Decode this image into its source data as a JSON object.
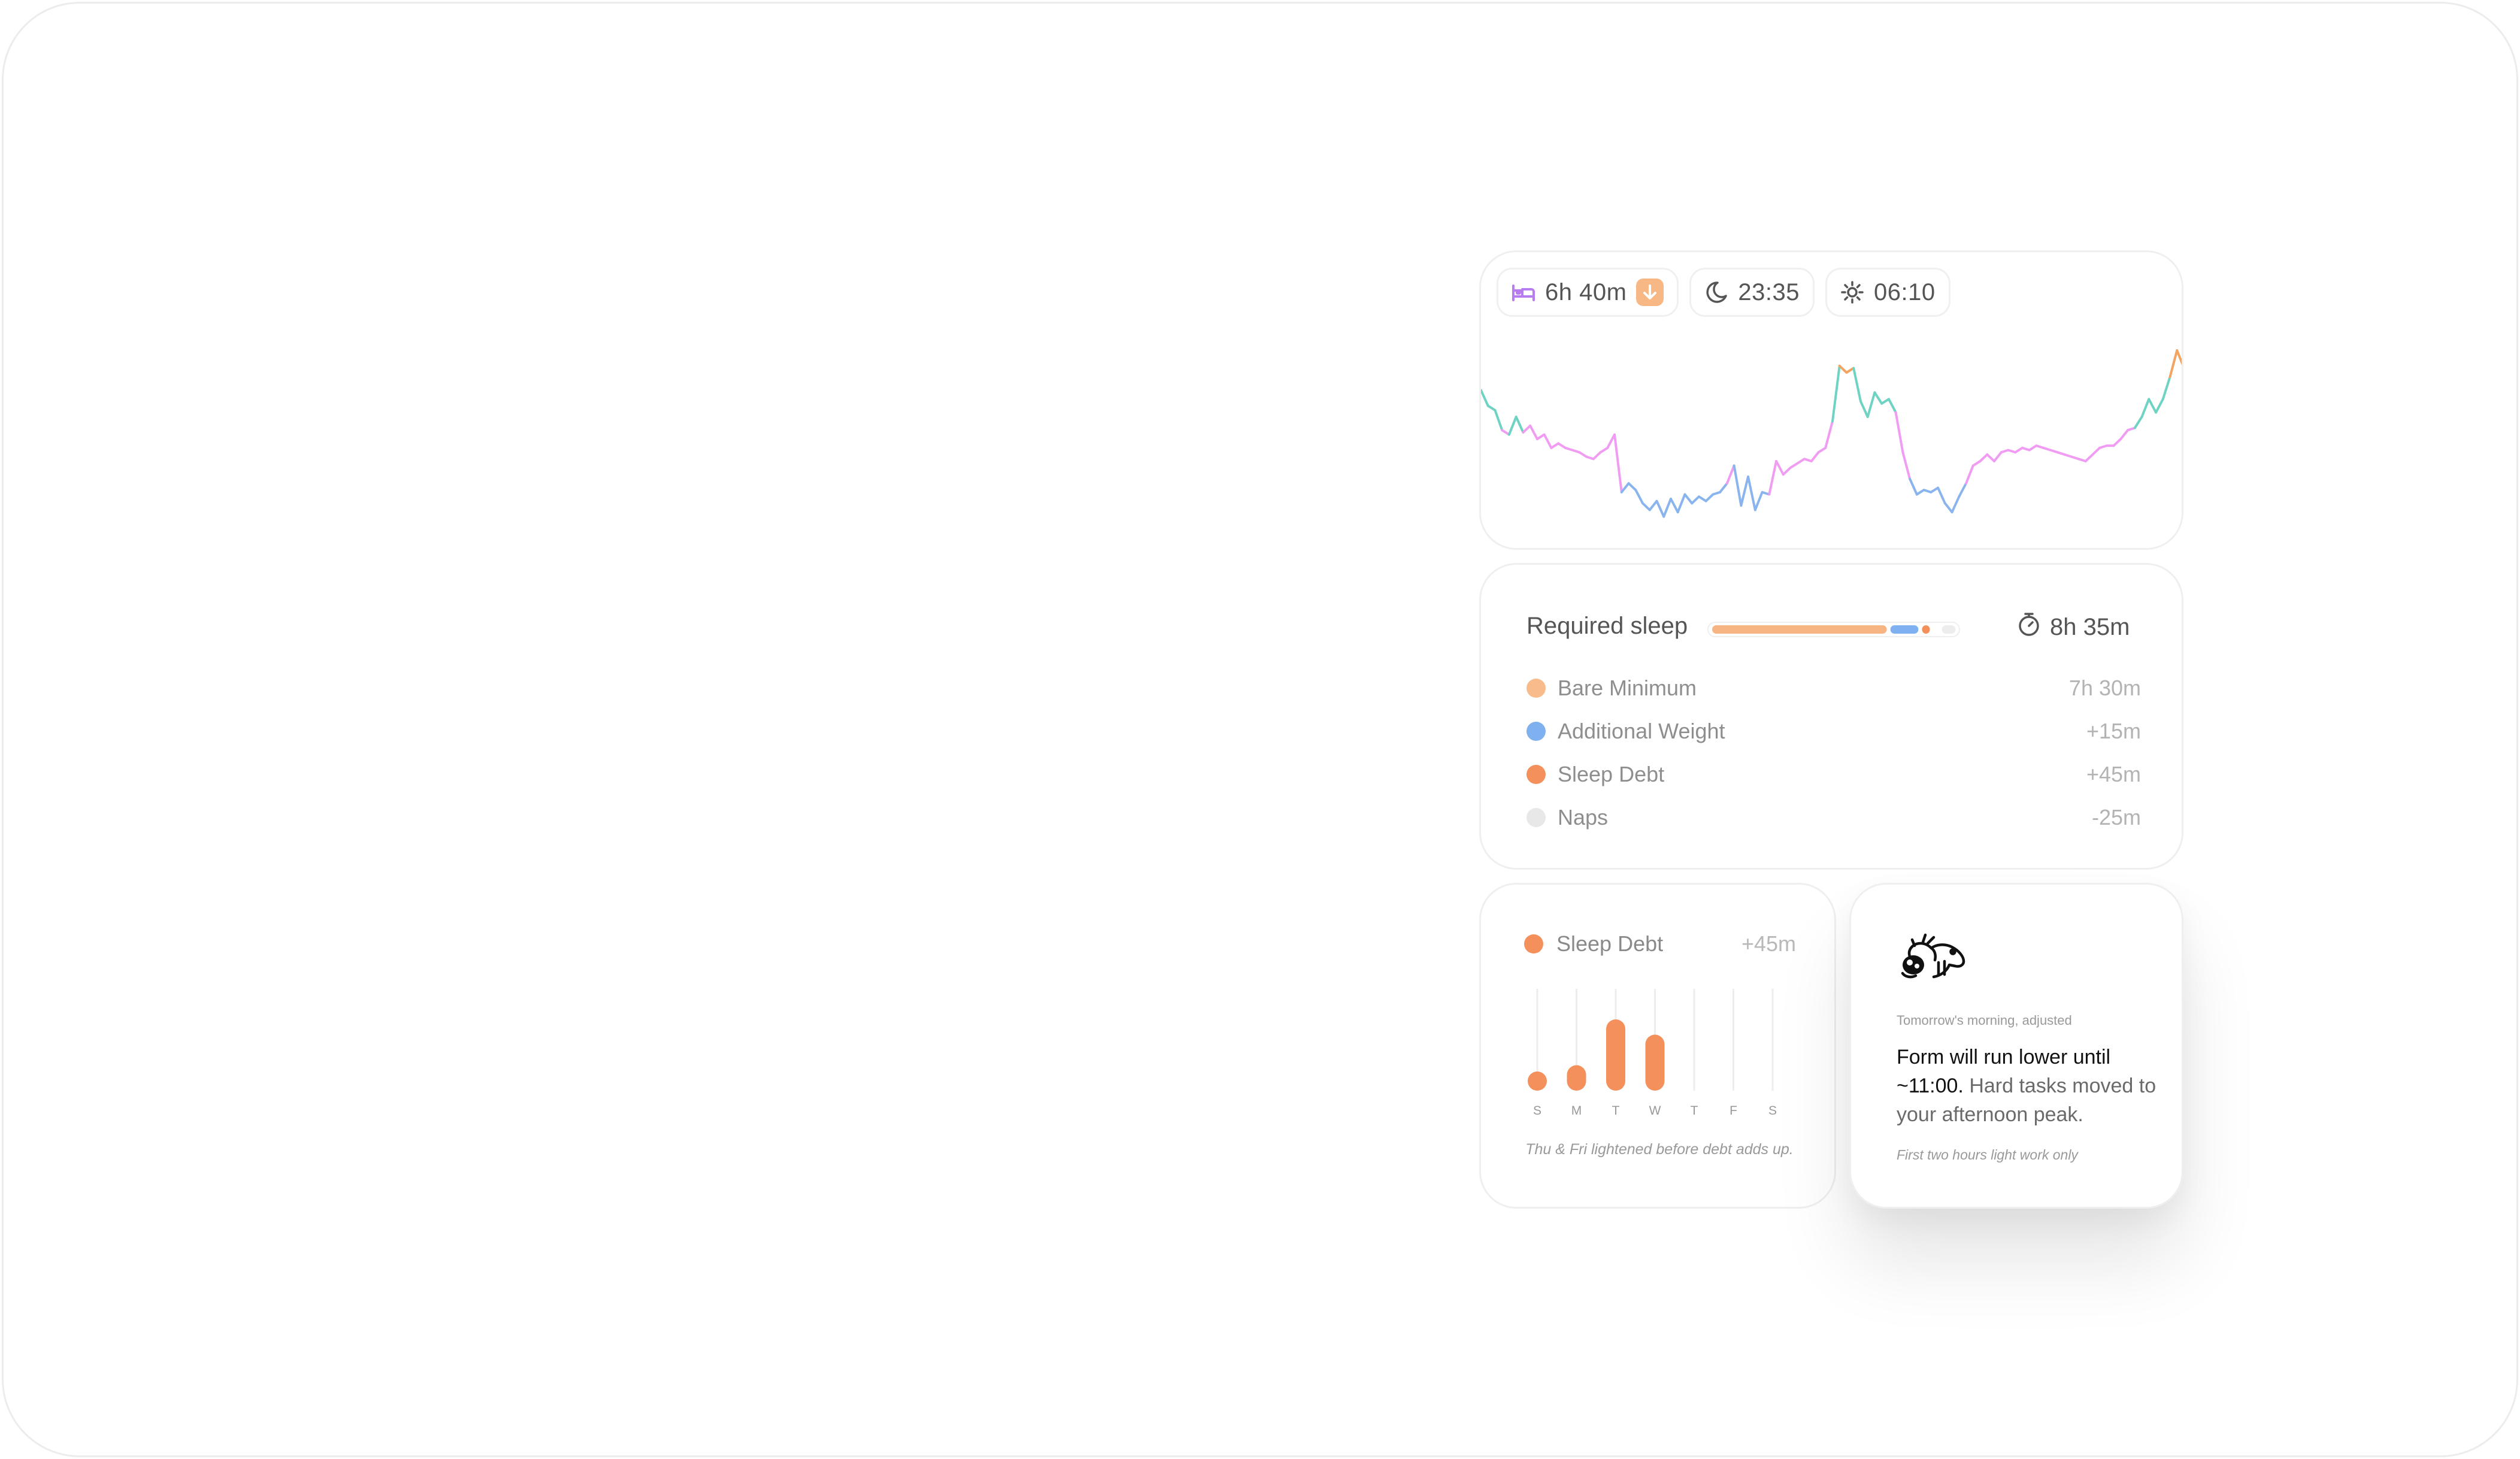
{
  "chart_card": {
    "duration": "6h 40m",
    "bedtime": "23:35",
    "wake_time": "06:10",
    "icons": [
      "bed-icon",
      "arrow-down-icon",
      "moon-icon",
      "sun-icon"
    ]
  },
  "chart_data": {
    "type": "line",
    "description_colors": {
      "low": "#8ab4ee",
      "mid": "#f19cf3",
      "high": "#6fd3c4",
      "peak": "#f2a463"
    },
    "values": [
      62,
      55,
      53,
      44,
      42,
      50,
      43,
      46,
      40,
      42,
      36,
      38,
      36,
      35,
      34,
      32,
      31,
      34,
      36,
      42,
      16,
      20,
      17,
      11,
      8,
      12,
      5,
      13,
      7,
      15,
      11,
      14,
      12,
      15,
      16,
      20,
      28,
      10,
      23,
      8,
      16,
      15,
      30,
      24,
      27,
      29,
      31,
      30,
      34,
      36,
      48,
      73,
      70,
      72,
      57,
      50,
      61,
      56,
      58,
      52,
      34,
      22,
      15,
      17,
      16,
      18,
      11,
      7,
      14,
      20,
      28,
      30,
      33,
      30,
      34,
      35,
      34,
      36,
      35,
      37,
      36,
      35,
      34,
      33,
      32,
      31,
      30,
      33,
      36,
      37,
      37,
      40,
      44,
      45,
      50,
      58,
      52,
      58,
      68,
      80,
      72
    ]
  },
  "required": {
    "title": "Required sleep",
    "total": "8h 35m",
    "bar_segments": [
      {
        "color": "#f7b584",
        "fraction": 0.62
      },
      {
        "color": "#7fb1f0",
        "fraction": 0.11
      },
      {
        "color": "#f3905c",
        "fraction": 0.04
      },
      {
        "color": "#ededed",
        "fraction": 0.06
      }
    ],
    "items": [
      {
        "label": "Bare Minimum",
        "value": "7h 30m",
        "color": "#f8bc8c"
      },
      {
        "label": "Additional Weight",
        "value": "+15m",
        "color": "#7fb1f0"
      },
      {
        "label": "Sleep Debt",
        "value": "+45m",
        "color": "#f3905c"
      },
      {
        "label": "Naps",
        "value": "-25m",
        "color": "#e8e8e8"
      }
    ]
  },
  "debt": {
    "title": "Sleep Debt",
    "value": "+45m",
    "days": [
      "S",
      "M",
      "T",
      "W",
      "T",
      "F",
      "S"
    ],
    "levels": [
      0.12,
      0.25,
      0.7,
      0.55,
      0,
      0,
      0
    ],
    "note": "Thu & Fri lightened before debt adds up."
  },
  "insight": {
    "eyebrow": "Tomorrow's morning, adjusted",
    "strong_text": "Form will run lower until ~11:00.",
    "rest_text": " Hard tasks moved to your afternoon peak.",
    "footnote": "First two hours light work only"
  }
}
